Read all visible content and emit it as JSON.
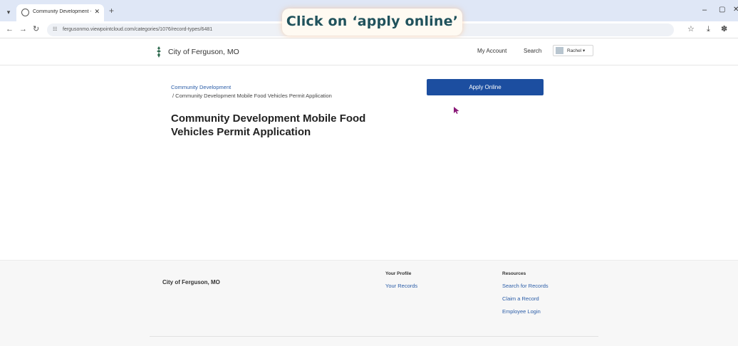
{
  "browser": {
    "tab_title": "Community Development - City",
    "new_tab_glyph": "+",
    "close_glyph": "✕",
    "url": "fergusonmo.viewpointcloud.com/categories/1076/record-types/6481",
    "nav": {
      "back": "←",
      "forward": "→",
      "reload": "↻"
    },
    "window": {
      "minimize": "–",
      "maximize": "▢",
      "close": "✕"
    },
    "toolbar_icons": {
      "bookmark": "☆",
      "download": "⤓",
      "extensions": "✽"
    }
  },
  "instruction": {
    "text": "Click on ‘apply online’"
  },
  "header": {
    "site_name": "City of Ferguson, MO",
    "my_account": "My Account",
    "search": "Search",
    "user": "Rachel ▾"
  },
  "main": {
    "breadcrumb_parent": "Community Development",
    "breadcrumb_current": "/   Community Development Mobile Food Vehicles Permit Application",
    "title": "Community Development Mobile Food Vehicles Permit Application",
    "apply_button": "Apply Online"
  },
  "footer": {
    "brand": "City of Ferguson, MO",
    "profile_heading": "Your Profile",
    "profile_links": [
      "Your Records"
    ],
    "resources_heading": "Resources",
    "resources_links": [
      "Search for Records",
      "Claim a Record",
      "Employee Login"
    ]
  },
  "colors": {
    "primary_button": "#1c4ea0",
    "link": "#2c5ea8",
    "banner_text": "#20525c",
    "tabstrip": "#dfe7f6"
  }
}
